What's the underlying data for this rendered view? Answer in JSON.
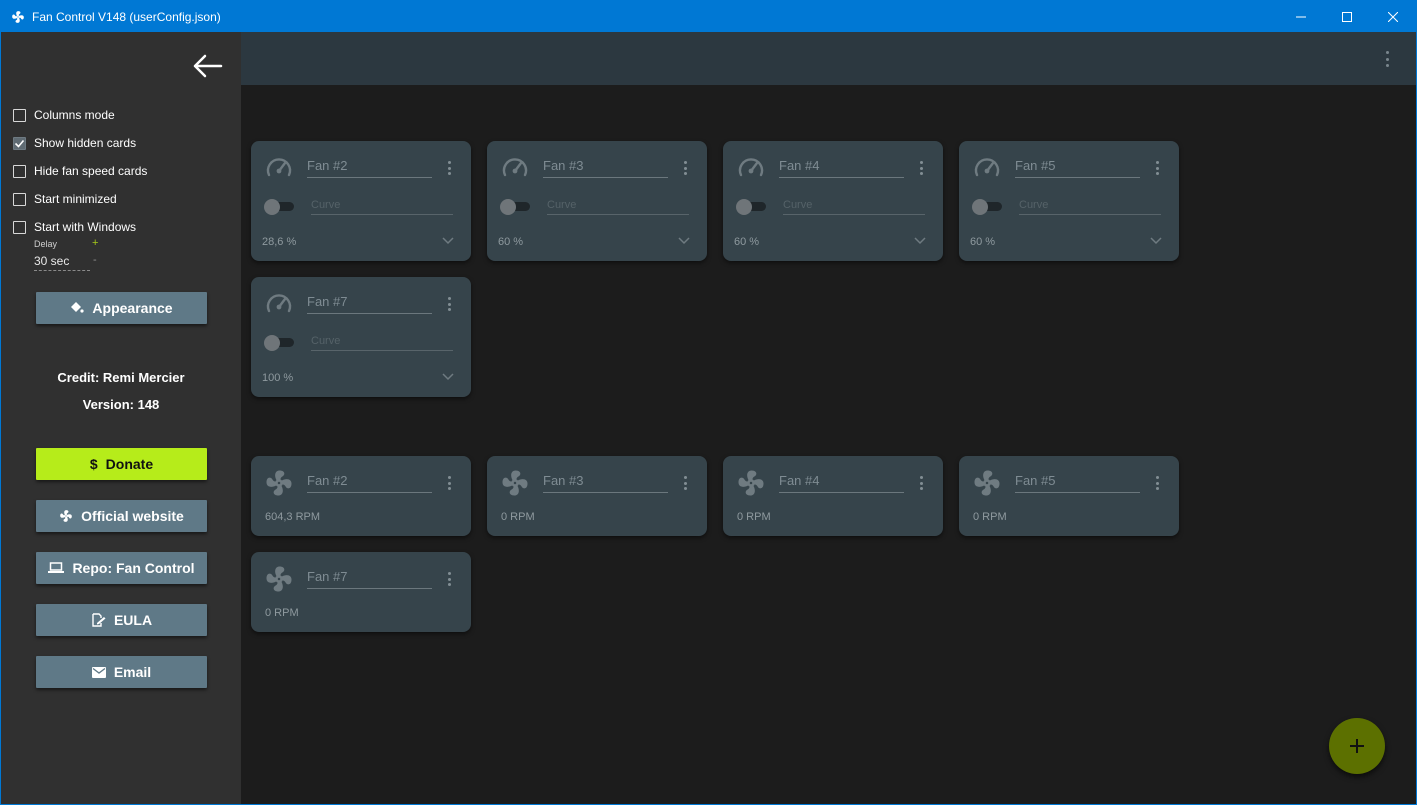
{
  "window": {
    "title": "Fan Control V148 (userConfig.json)",
    "accent_color": "#0078d4"
  },
  "sidebar": {
    "checkboxes": [
      {
        "label": "Columns mode",
        "checked": false
      },
      {
        "label": "Show hidden cards",
        "checked": true
      },
      {
        "label": "Hide fan speed cards",
        "checked": false
      },
      {
        "label": "Start minimized",
        "checked": false
      },
      {
        "label": "Start with Windows",
        "checked": false
      }
    ],
    "delay": {
      "label": "Delay",
      "value": "30 sec",
      "plus": "+",
      "minus": "-"
    },
    "appearance_label": "Appearance",
    "credit": "Credit: Remi Mercier",
    "version": "Version: 148",
    "buttons": {
      "donate": "Donate",
      "website": "Official website",
      "repo": "Repo: Fan Control",
      "eula": "EULA",
      "email": "Email"
    },
    "donate_color": "#b6ec1a"
  },
  "control_cards": [
    {
      "name": "Fan #2",
      "curve_placeholder": "Curve",
      "percent": "28,6 %",
      "icon": "speedometer-icon"
    },
    {
      "name": "Fan #3",
      "curve_placeholder": "Curve",
      "percent": "60 %",
      "icon": "speedometer-icon"
    },
    {
      "name": "Fan #4",
      "curve_placeholder": "Curve",
      "percent": "60 %",
      "icon": "speedometer-icon"
    },
    {
      "name": "Fan #5",
      "curve_placeholder": "Curve",
      "percent": "60 %",
      "icon": "speedometer-icon"
    },
    {
      "name": "Fan #7",
      "curve_placeholder": "Curve",
      "percent": "100 %",
      "icon": "speedometer-icon"
    }
  ],
  "speed_cards": [
    {
      "name": "Fan #2",
      "rpm": "604,3 RPM",
      "icon": "fan-icon"
    },
    {
      "name": "Fan #3",
      "rpm": "0 RPM",
      "icon": "fan-icon"
    },
    {
      "name": "Fan #4",
      "rpm": "0 RPM",
      "icon": "fan-icon"
    },
    {
      "name": "Fan #5",
      "rpm": "0 RPM",
      "icon": "fan-icon"
    },
    {
      "name": "Fan #7",
      "rpm": "0 RPM",
      "icon": "fan-icon"
    }
  ],
  "fab": {
    "label": "+",
    "color": "#5c7000"
  }
}
